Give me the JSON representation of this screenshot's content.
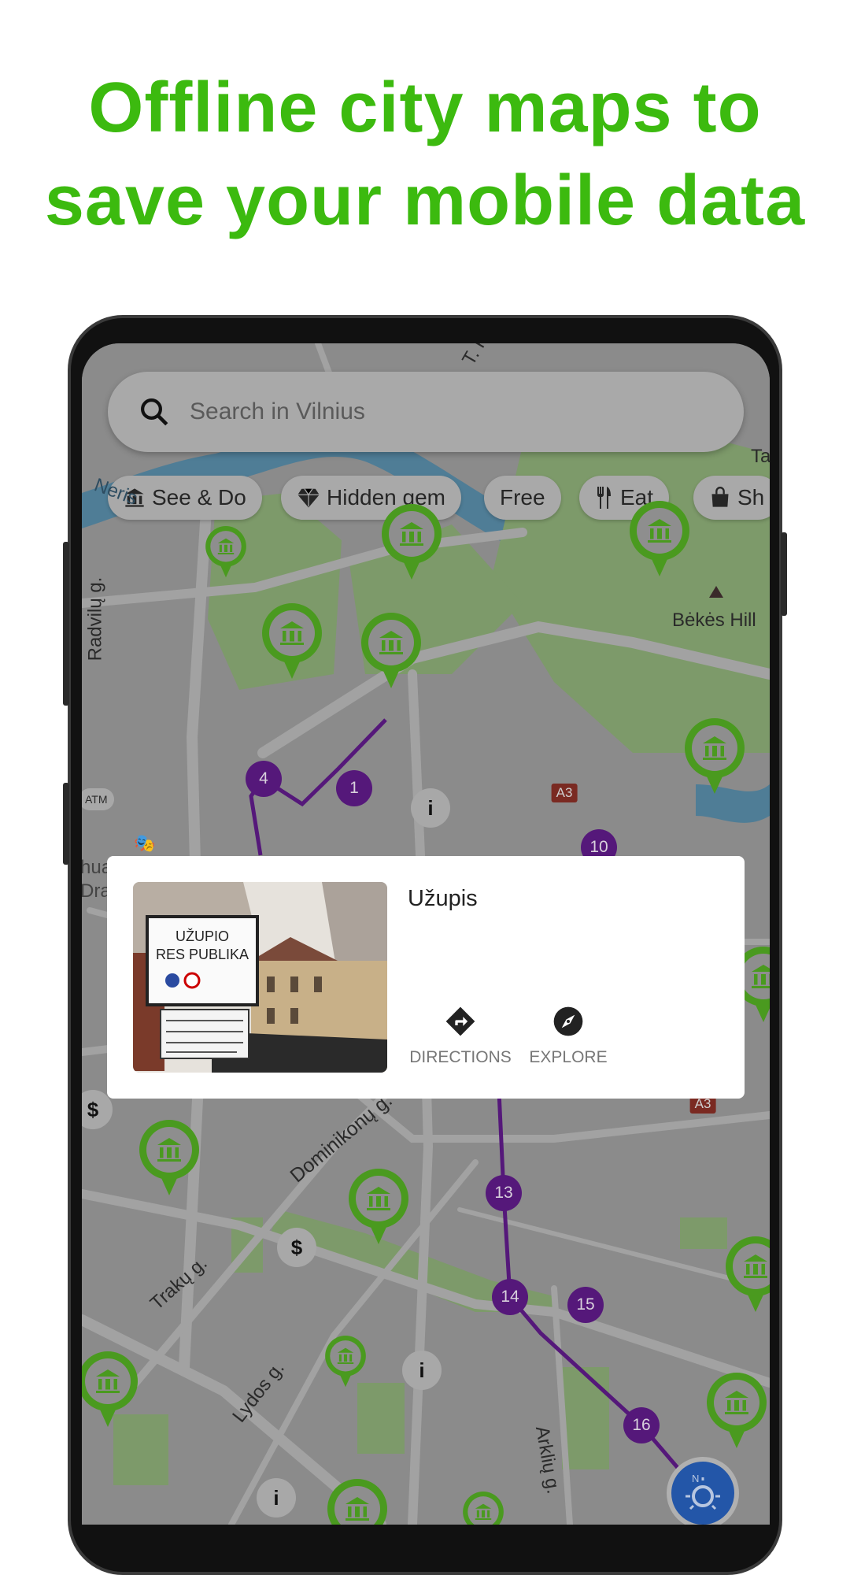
{
  "headline": {
    "line1": "Offline city maps to",
    "line2": "save your mobile data"
  },
  "colors": {
    "brand_green": "#3cba0f",
    "pin_green": "#4a9a1f",
    "route_purple": "#55187a",
    "compass_blue": "#2356a8"
  },
  "search": {
    "placeholder": "Search in Vilnius",
    "icon": "search-icon"
  },
  "chips": [
    {
      "label": "See & Do",
      "icon": "museum-icon"
    },
    {
      "label": "Hidden gem",
      "icon": "diamond-icon"
    },
    {
      "label": "Free"
    },
    {
      "label": "Eat",
      "icon": "fork-knife-icon"
    },
    {
      "label": "Sh",
      "icon": "shopping-bag-icon"
    }
  ],
  "map": {
    "labels": {
      "hill": "Bėkės Hill",
      "radvilu": "Radvilų g.",
      "dominikonu": "Dominikonų g.",
      "traku": "Trakų g.",
      "lydos": "Lydos g.",
      "arkliu": "Arklių g.",
      "neris": "Neris",
      "ta": "Ta",
      "tk": "T. K",
      "atm": "ATM",
      "dra": "Dra",
      "hua": "hua"
    },
    "route_stops": [
      "4",
      "1",
      "10",
      "13",
      "14",
      "15",
      "16"
    ],
    "road_badges": [
      "A3",
      "A3"
    ],
    "info_symbol": "i",
    "money_symbol": "$"
  },
  "card": {
    "title": "Užupis",
    "photo_sign": {
      "line1": "UŽUPIO",
      "line2": "RES PUBLIKA"
    },
    "actions": [
      {
        "label": "DIRECTIONS",
        "icon": "directions-icon"
      },
      {
        "label": "EXPLORE",
        "icon": "compass-icon"
      }
    ]
  },
  "compass": {
    "letter": "N"
  }
}
